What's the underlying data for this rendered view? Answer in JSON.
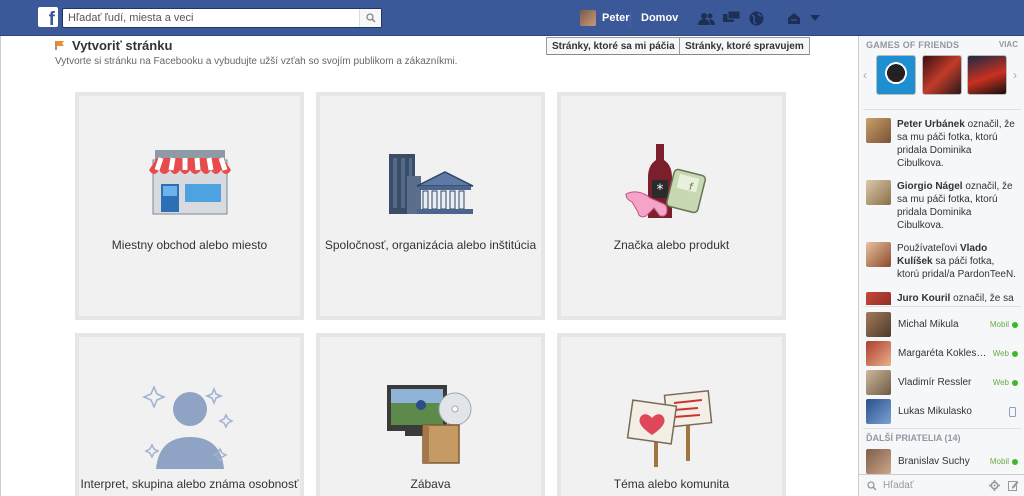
{
  "topbar": {
    "logo": "f",
    "search_placeholder": "Hľadať ľudí, miesta a veci",
    "user_name": "Peter",
    "home_label": "Domov"
  },
  "header": {
    "title": "Vytvoriť stránku",
    "subtitle": "Vytvorte si stránku na Facebooku a vybudujte užší vzťah so svojím publikom a zákazníkmi.",
    "btn_liked": "Stránky, ktoré sa mi páčia",
    "btn_managed": "Stránky, ktoré spravujem"
  },
  "tiles": [
    {
      "label": "Miestny obchod alebo miesto",
      "icon": "storefront-icon"
    },
    {
      "label": "Spoločnosť, organizácia alebo inštitúcia",
      "icon": "buildings-icon"
    },
    {
      "label": "Značka alebo produkt",
      "icon": "products-icon"
    },
    {
      "label": "Interpret, skupina alebo známa osobnosť",
      "icon": "person-sparkles-icon"
    },
    {
      "label": "Zábava",
      "icon": "tv-media-icon"
    },
    {
      "label": "Téma alebo komunita",
      "icon": "signs-heart-icon"
    }
  ],
  "sidebar": {
    "games_title": "GAMES OF FRIENDS",
    "games_more": "VIAC",
    "ticker": [
      {
        "name": "Peter Urbánek",
        "text": " označil, že sa mu páči fotka, ktorú pridala Dominika Cibulkova."
      },
      {
        "name": "Giorgio Nágel",
        "text": " označil, že sa mu páči fotka, ktorú pridala Dominika Cibulkova."
      },
      {
        "prefix": "Používateľovi ",
        "name": "Vlado Kulíšek",
        "text": " sa páči fotka, ktorú pridal/a PardonTeeN."
      },
      {
        "name": "Juro Kouril",
        "text": " označil, že sa"
      }
    ],
    "friends": [
      {
        "name": "Michal Mikula",
        "source": "Mobil"
      },
      {
        "name": "Margaréta Kokles…",
        "source": "Web"
      },
      {
        "name": "Vladimír Ressler",
        "source": "Web"
      },
      {
        "name": "Lukas Mikulasko",
        "source": ""
      }
    ],
    "more_friends": "ĎALŠÍ PRIATELIA (14)",
    "more_list": [
      {
        "name": "Branislav Suchy",
        "source": "Mobil"
      }
    ],
    "search_label": "Hľadať"
  },
  "colors": {
    "brand": "#3b5998",
    "online": "#42b72a"
  }
}
